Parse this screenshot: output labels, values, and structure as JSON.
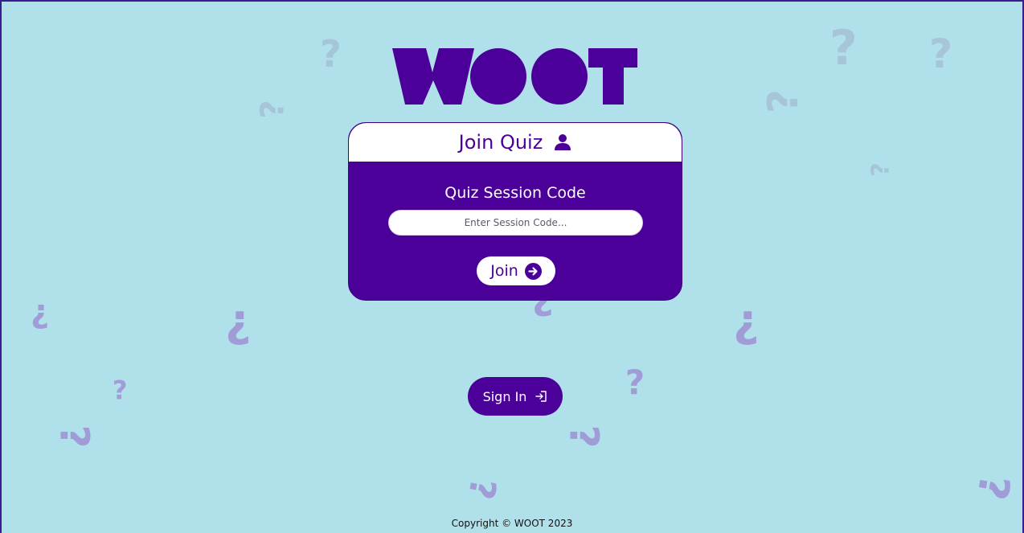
{
  "app": {
    "logo_text": "WOOT"
  },
  "join_card": {
    "title": "Join Quiz",
    "title_icon": "user-icon",
    "field_label": "Quiz Session Code",
    "input_placeholder": "Enter Session Code...",
    "input_value": "",
    "join_label": "Join",
    "join_icon": "arrow-circle-right-icon"
  },
  "signin": {
    "label": "Sign In",
    "icon": "sign-in-icon"
  },
  "footer": {
    "copyright": "Copyright © WOOT 2023"
  },
  "colors": {
    "background": "#b0e0ea",
    "primary": "#4a0099",
    "decoration_light": "#a6c5d6",
    "decoration_purple": "#a09cd8",
    "white": "#ffffff"
  },
  "decorations": {
    "glyph_upright": "?",
    "glyph_inverted": "¿"
  }
}
